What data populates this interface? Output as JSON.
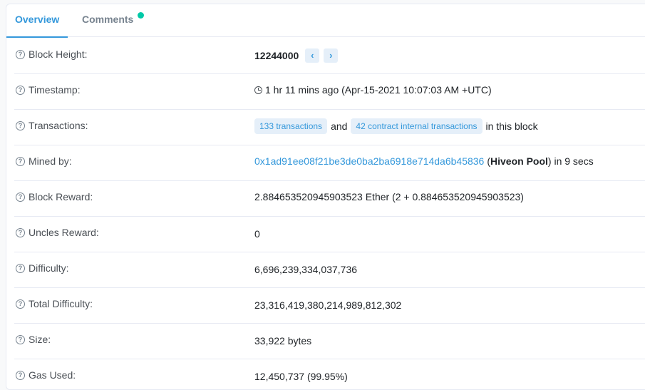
{
  "tabs": {
    "overview": "Overview",
    "comments": "Comments"
  },
  "rows": {
    "block_height": {
      "label": "Block Height:",
      "value": "12244000",
      "prev": "‹",
      "next": "›"
    },
    "timestamp": {
      "label": "Timestamp:",
      "value": "1 hr 11 mins ago (Apr-15-2021 10:07:03 AM +UTC)"
    },
    "transactions": {
      "label": "Transactions:",
      "tx_link": "133 transactions",
      "and": "and",
      "internal_link": "42 contract internal transactions",
      "suffix": "in this block"
    },
    "mined_by": {
      "label": "Mined by:",
      "address": "0x1ad91ee08f21be3de0ba2ba6918e714da6b45836",
      "open_paren": "(",
      "pool": "Hiveon Pool",
      "suffix": ") in 9 secs"
    },
    "block_reward": {
      "label": "Block Reward:",
      "value": "2.884653520945903523 Ether (2 + 0.884653520945903523)"
    },
    "uncles_reward": {
      "label": "Uncles Reward:",
      "value": "0"
    },
    "difficulty": {
      "label": "Difficulty:",
      "value": "6,696,239,334,037,736"
    },
    "total_difficulty": {
      "label": "Total Difficulty:",
      "value": "23,316,419,380,214,989,812,302"
    },
    "size": {
      "label": "Size:",
      "value": "33,922 bytes"
    },
    "gas_used": {
      "label": "Gas Used:",
      "value": "12,450,737 (99.95%)"
    }
  },
  "colors": {
    "accent": "#3498db",
    "badge_dot": "#00c9a7",
    "pill_bg": "#e5eff9"
  }
}
